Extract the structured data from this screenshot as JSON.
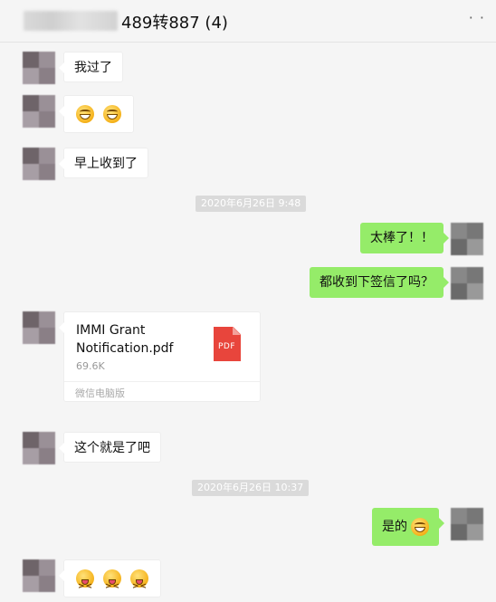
{
  "header": {
    "title": "489转887  (4)",
    "more_icon": "more-icon"
  },
  "messages": [
    {
      "side": "in",
      "text": "我过了"
    },
    {
      "side": "in",
      "emoji": [
        "grin-sweat",
        "grin-sweat"
      ]
    },
    {
      "side": "in",
      "text": "早上收到了"
    },
    {
      "time": "2020年6月26日 9:48"
    },
    {
      "side": "out",
      "text": "太棒了！！"
    },
    {
      "side": "out",
      "text": "都收到下签信了吗？"
    },
    {
      "side": "in",
      "file": {
        "name": "IMMI Grant Notification.pdf",
        "size": "69.6K",
        "source": "微信电脑版",
        "icon_label": "PDF"
      }
    },
    {
      "side": "in",
      "text": "这个就是了吧"
    },
    {
      "time": "2020年6月26日 10:37"
    },
    {
      "side": "out",
      "text": "是的",
      "emoji": [
        "grin"
      ]
    },
    {
      "side": "in",
      "emoji": [
        "squint-tongue",
        "squint-tongue",
        "squint-tongue"
      ]
    }
  ],
  "colors": {
    "out_bubble": "#95ec69",
    "in_bubble": "#ffffff",
    "background": "#f5f5f5",
    "pdf": "#e8453c"
  }
}
